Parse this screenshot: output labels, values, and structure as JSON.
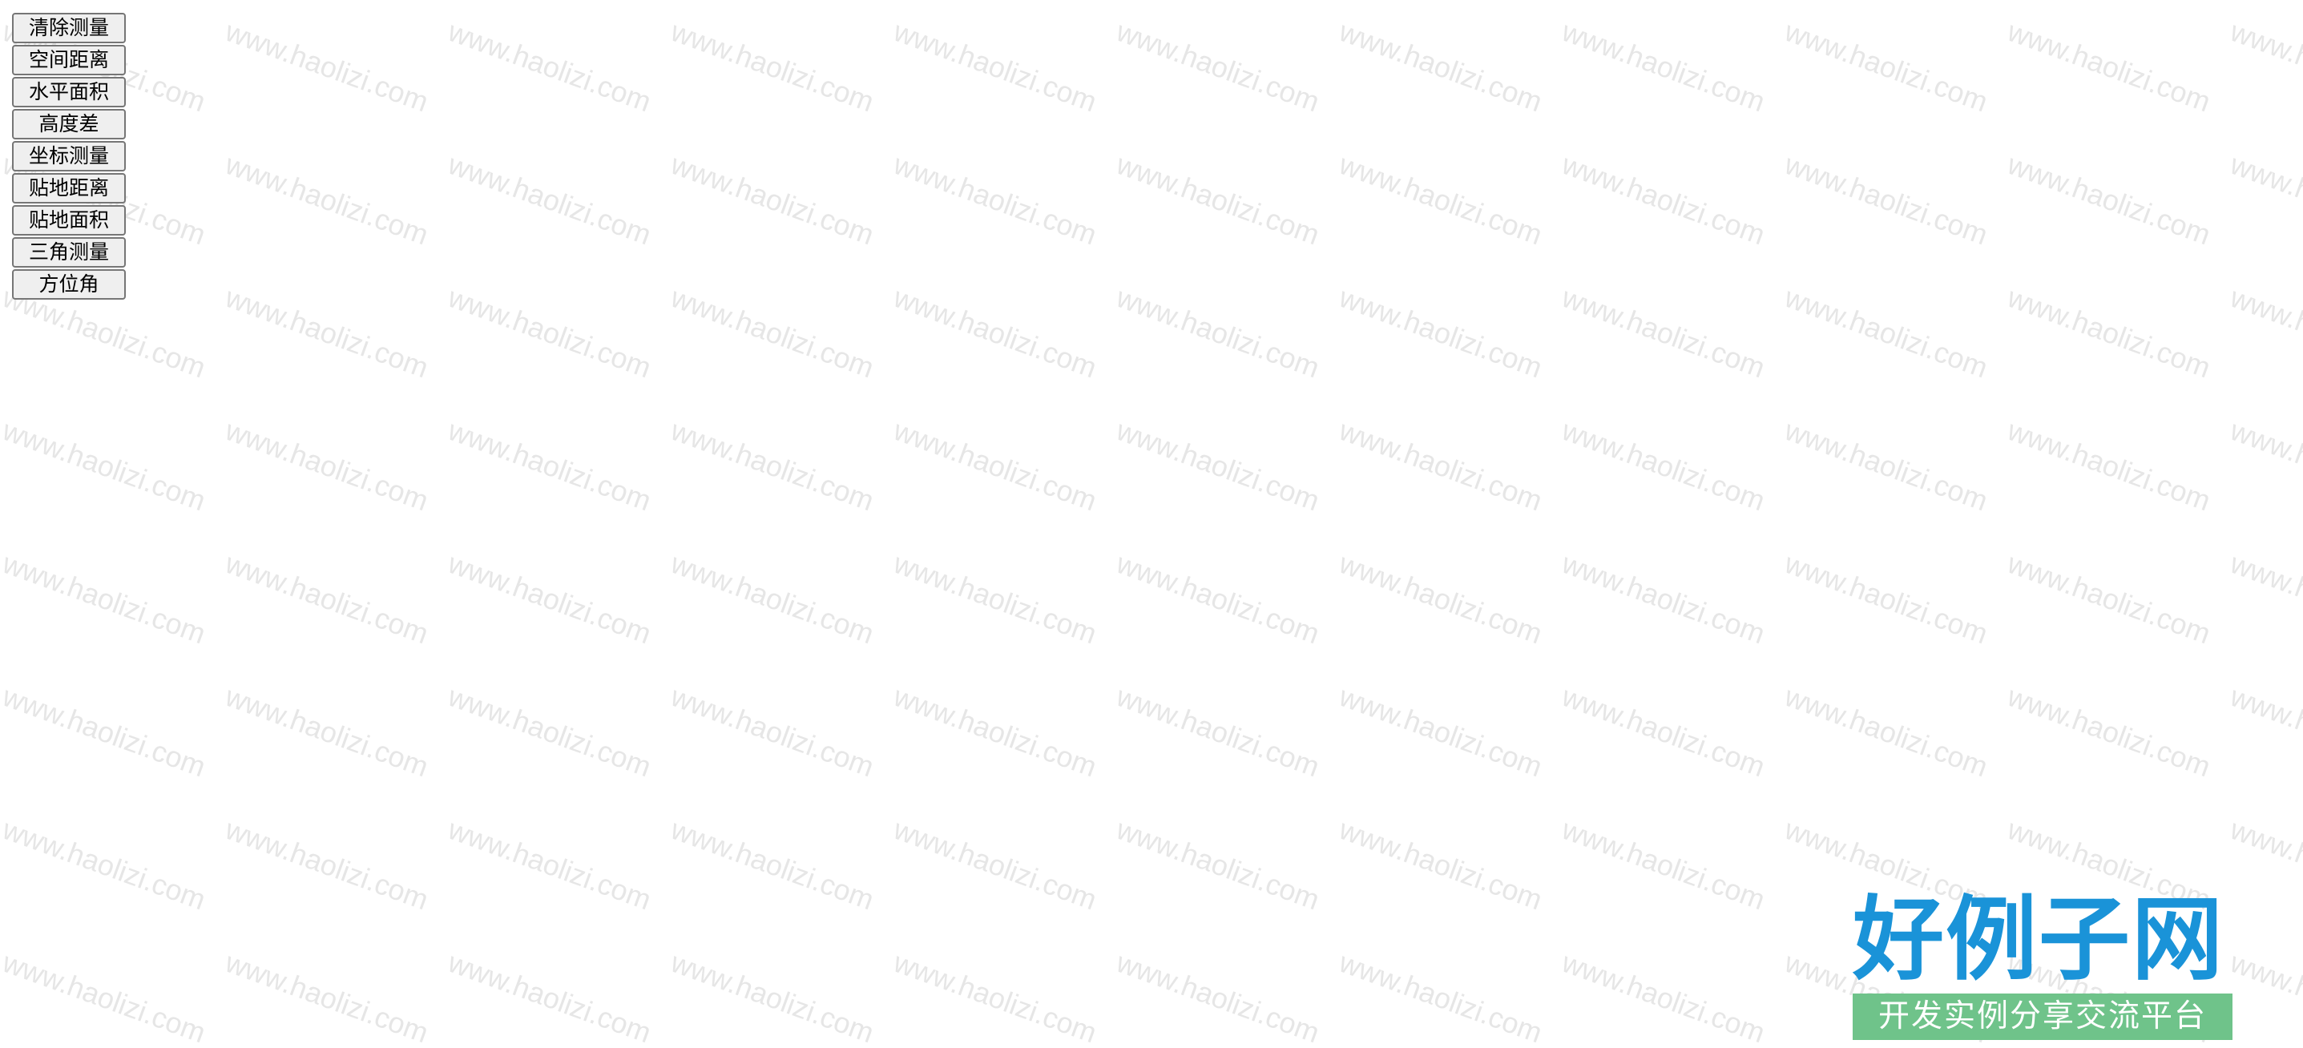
{
  "watermark": {
    "text": "www.haolizi.com",
    "color": "#e6e6e6"
  },
  "toolbar": {
    "buttons": [
      {
        "id": "clear",
        "label": "清除测量"
      },
      {
        "id": "space-distance",
        "label": "空间距离"
      },
      {
        "id": "horizontal-area",
        "label": "水平面积"
      },
      {
        "id": "height-diff",
        "label": "高度差"
      },
      {
        "id": "coordinate",
        "label": "坐标测量"
      },
      {
        "id": "ground-distance",
        "label": "贴地距离"
      },
      {
        "id": "ground-area",
        "label": "贴地面积"
      },
      {
        "id": "triangle",
        "label": "三角测量"
      },
      {
        "id": "azimuth",
        "label": "方位角"
      }
    ]
  },
  "brand": {
    "title": "好例子网",
    "slogan": "开发实例分享交流平台",
    "title_color": "#1a93d8",
    "slogan_bg": "#6fc38a"
  }
}
